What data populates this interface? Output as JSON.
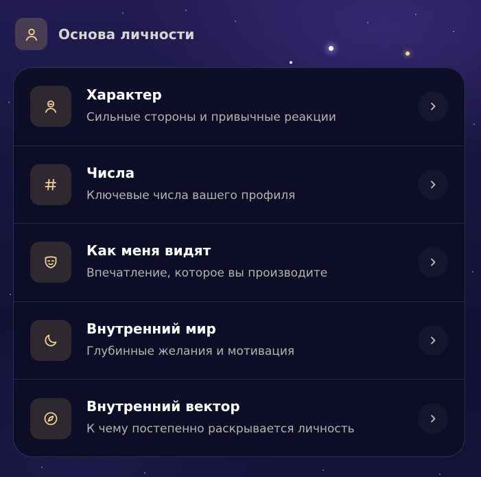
{
  "header": {
    "title": "Основа личности",
    "icon": "person-icon"
  },
  "colors": {
    "accent": "#f2cf95",
    "background": "#17163f",
    "card": "#0d0d26",
    "icon_tile": "#2e2930"
  },
  "items": [
    {
      "title": "Характер",
      "subtitle": "Сильные стороны и привычные реакции",
      "icon": "face-icon"
    },
    {
      "title": "Числа",
      "subtitle": "Ключевые числа вашего профиля",
      "icon": "hash-icon"
    },
    {
      "title": "Как меня видят",
      "subtitle": "Впечатление, которое вы производите",
      "icon": "mask-icon"
    },
    {
      "title": "Внутренний мир",
      "subtitle": "Глубинные желания и мотивация",
      "icon": "moon-icon"
    },
    {
      "title": "Внутренний вектор",
      "subtitle": "К чему постепенно раскрывается личность",
      "icon": "compass-icon"
    }
  ]
}
